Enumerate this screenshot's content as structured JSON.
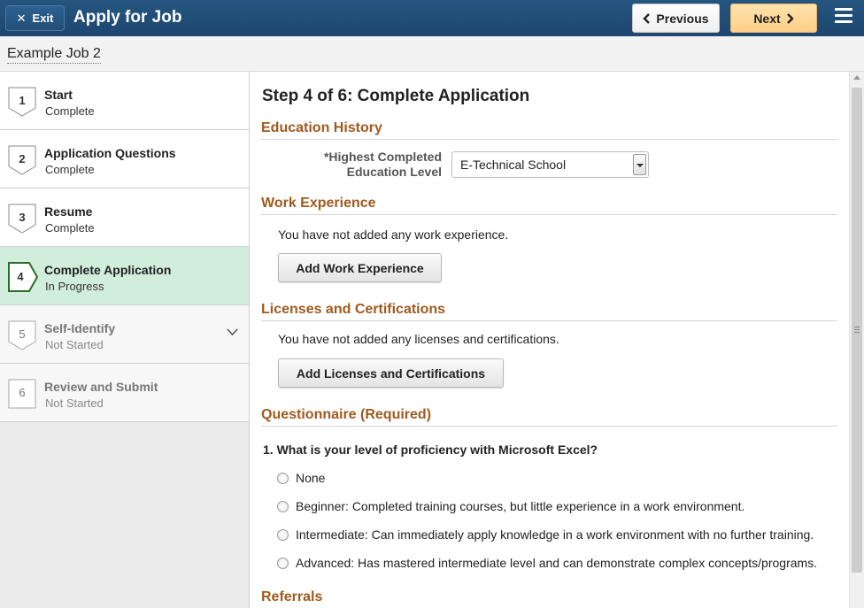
{
  "header": {
    "exit_label": "Exit",
    "title": "Apply for Job",
    "previous_label": "Previous",
    "next_label": "Next"
  },
  "subheader": {
    "job_name": "Example Job 2"
  },
  "steps": [
    {
      "number": "1",
      "label": "Start",
      "status": "Complete"
    },
    {
      "number": "2",
      "label": "Application Questions",
      "status": "Complete"
    },
    {
      "number": "3",
      "label": "Resume",
      "status": "Complete"
    },
    {
      "number": "4",
      "label": "Complete Application",
      "status": "In Progress"
    },
    {
      "number": "5",
      "label": "Self-Identify",
      "status": "Not Started"
    },
    {
      "number": "6",
      "label": "Review and Submit",
      "status": "Not Started"
    }
  ],
  "main": {
    "title": "Step 4 of 6: Complete Application",
    "education": {
      "heading": "Education History",
      "field_label": "*Highest Completed Education Level",
      "selected_value": "E-Technical School"
    },
    "work": {
      "heading": "Work Experience",
      "empty_text": "You have not added any work experience.",
      "add_label": "Add Work Experience"
    },
    "licenses": {
      "heading": "Licenses and Certifications",
      "empty_text": "You have not added any licenses and certifications.",
      "add_label": "Add Licenses and Certifications"
    },
    "questionnaire": {
      "heading": "Questionnaire (Required)",
      "question": "1. What is your level of proficiency with Microsoft Excel?",
      "options": [
        "None",
        "Beginner: Completed training courses, but little experience in a work environment.",
        "Intermediate: Can immediately apply knowledge in a work environment with no further training.",
        "Advanced: Has mastered intermediate level and can demonstrate complex concepts/programs."
      ]
    },
    "referrals": {
      "heading": "Referrals"
    }
  },
  "colors": {
    "header_bg": "#1d4670",
    "section_heading": "#a05a1e",
    "active_step_bg": "#d1eddb",
    "next_button": "#ffcf85"
  }
}
